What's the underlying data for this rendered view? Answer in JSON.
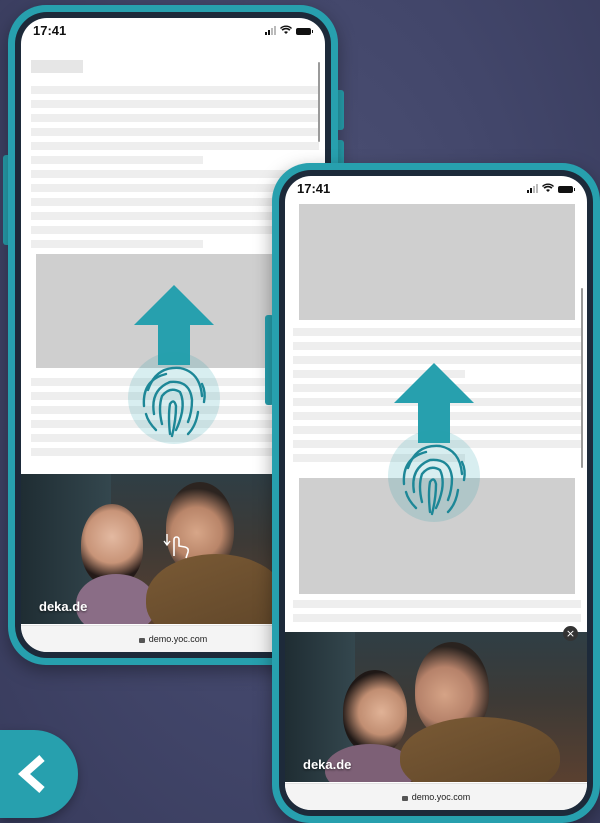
{
  "colors": {
    "accent": "#27a0ae",
    "background": "#42466a",
    "placeholder_block": "#cfcfcf",
    "placeholder_line": "#eeeeee"
  },
  "phone_back": {
    "status_time": "17:41",
    "ad_brand": "deka.de",
    "url": "demo.yoc.com",
    "gesture_icons": [
      "arrow-up-icon",
      "fingerprint-icon",
      "tap-hand-icon"
    ]
  },
  "phone_front": {
    "status_time": "17:41",
    "ad_brand": "deka.de",
    "url": "demo.yoc.com",
    "close_symbol": "×",
    "gesture_icons": [
      "arrow-up-icon",
      "fingerprint-icon"
    ]
  },
  "navigation": {
    "back_icon": "chevron-left-icon"
  }
}
